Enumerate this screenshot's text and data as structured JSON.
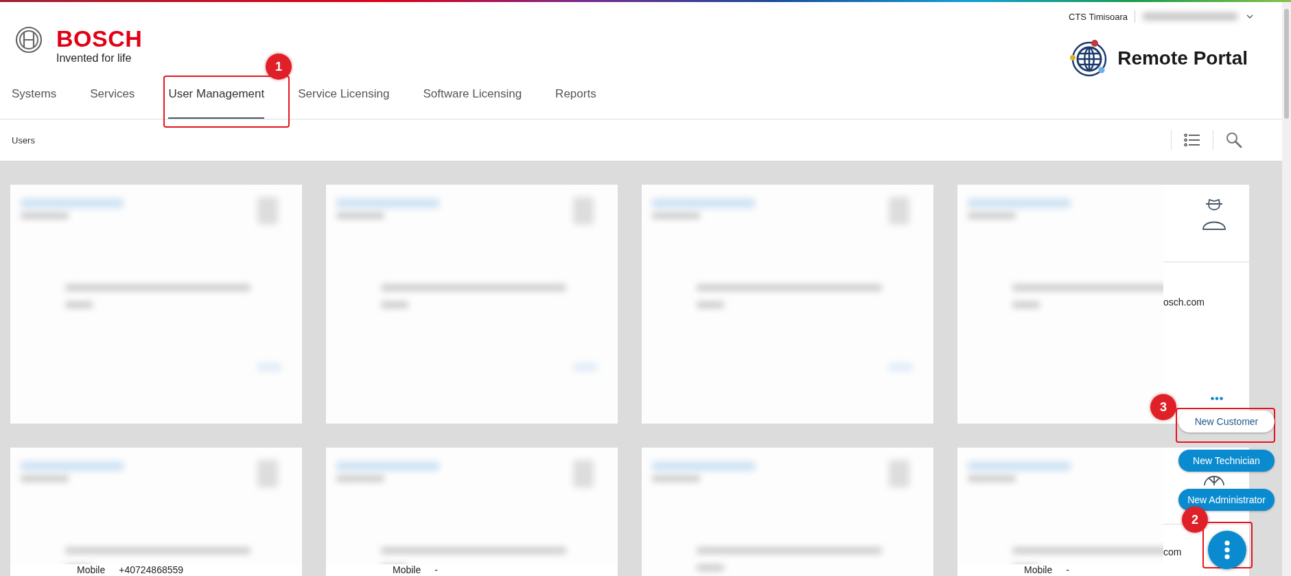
{
  "header": {
    "brand": "BOSCH",
    "tagline": "Invented for life",
    "location": "CTS Timisoara",
    "product": "Remote Portal"
  },
  "nav": {
    "tabs": [
      {
        "label": "Systems",
        "selected": false
      },
      {
        "label": "Services",
        "selected": false
      },
      {
        "label": "User Management",
        "selected": true
      },
      {
        "label": "Service Licensing",
        "selected": false
      },
      {
        "label": "Software Licensing",
        "selected": false
      },
      {
        "label": "Reports",
        "selected": false
      }
    ]
  },
  "toolbar": {
    "title": "Users"
  },
  "cards": [
    {
      "kind": "blurred"
    },
    {
      "kind": "blurred"
    },
    {
      "kind": "blurred"
    },
    {
      "kind": "partial",
      "email": "osch.com"
    },
    {
      "kind": "blurred",
      "mobile_label": "Mobile",
      "mobile": "+40724868559"
    },
    {
      "kind": "blurred",
      "mobile_label": "Mobile",
      "mobile": "-"
    },
    {
      "kind": "blurred"
    },
    {
      "kind": "partial",
      "email": "com",
      "mobile_label": "Mobile",
      "mobile": "-"
    }
  ],
  "speed_dial": {
    "actions": [
      {
        "label": "New Customer",
        "hovered": true
      },
      {
        "label": "New Technician",
        "hovered": false
      },
      {
        "label": "New Administrator",
        "hovered": false
      }
    ]
  },
  "annotations": [
    {
      "label": "1"
    },
    {
      "label": "2"
    },
    {
      "label": "3"
    }
  ]
}
